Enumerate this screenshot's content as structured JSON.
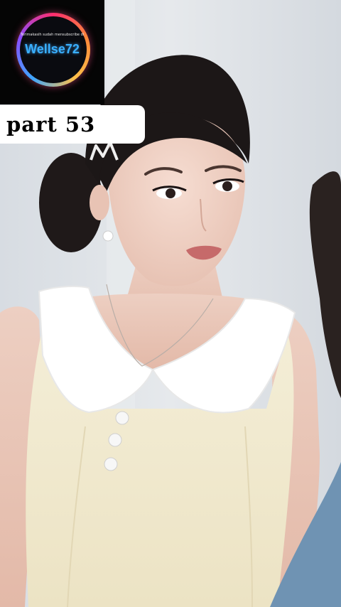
{
  "overlay": {
    "logo_subtitle": "Terimakasih sudah mensubscribe di",
    "logo_name": "Wellse72",
    "part_label": "part 53"
  },
  "colors": {
    "background": "#dfe3e7",
    "logo_background": "#050505",
    "logo_text": "#3ab0ff",
    "dress": "#f1ead0",
    "collar": "#ffffff",
    "hair": "#1c1717",
    "skin": "#efd1c4"
  }
}
